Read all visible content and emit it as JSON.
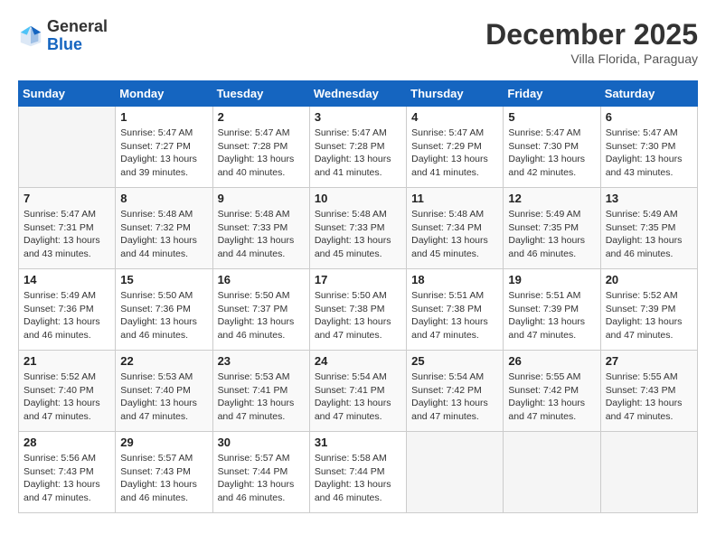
{
  "header": {
    "logo_general": "General",
    "logo_blue": "Blue",
    "month_title": "December 2025",
    "subtitle": "Villa Florida, Paraguay"
  },
  "weekdays": [
    "Sunday",
    "Monday",
    "Tuesday",
    "Wednesday",
    "Thursday",
    "Friday",
    "Saturday"
  ],
  "weeks": [
    [
      {
        "day": "",
        "empty": true
      },
      {
        "day": "1",
        "sunrise": "Sunrise: 5:47 AM",
        "sunset": "Sunset: 7:27 PM",
        "daylight": "Daylight: 13 hours and 39 minutes."
      },
      {
        "day": "2",
        "sunrise": "Sunrise: 5:47 AM",
        "sunset": "Sunset: 7:28 PM",
        "daylight": "Daylight: 13 hours and 40 minutes."
      },
      {
        "day": "3",
        "sunrise": "Sunrise: 5:47 AM",
        "sunset": "Sunset: 7:28 PM",
        "daylight": "Daylight: 13 hours and 41 minutes."
      },
      {
        "day": "4",
        "sunrise": "Sunrise: 5:47 AM",
        "sunset": "Sunset: 7:29 PM",
        "daylight": "Daylight: 13 hours and 41 minutes."
      },
      {
        "day": "5",
        "sunrise": "Sunrise: 5:47 AM",
        "sunset": "Sunset: 7:30 PM",
        "daylight": "Daylight: 13 hours and 42 minutes."
      },
      {
        "day": "6",
        "sunrise": "Sunrise: 5:47 AM",
        "sunset": "Sunset: 7:30 PM",
        "daylight": "Daylight: 13 hours and 43 minutes."
      }
    ],
    [
      {
        "day": "7",
        "sunrise": "Sunrise: 5:47 AM",
        "sunset": "Sunset: 7:31 PM",
        "daylight": "Daylight: 13 hours and 43 minutes."
      },
      {
        "day": "8",
        "sunrise": "Sunrise: 5:48 AM",
        "sunset": "Sunset: 7:32 PM",
        "daylight": "Daylight: 13 hours and 44 minutes."
      },
      {
        "day": "9",
        "sunrise": "Sunrise: 5:48 AM",
        "sunset": "Sunset: 7:33 PM",
        "daylight": "Daylight: 13 hours and 44 minutes."
      },
      {
        "day": "10",
        "sunrise": "Sunrise: 5:48 AM",
        "sunset": "Sunset: 7:33 PM",
        "daylight": "Daylight: 13 hours and 45 minutes."
      },
      {
        "day": "11",
        "sunrise": "Sunrise: 5:48 AM",
        "sunset": "Sunset: 7:34 PM",
        "daylight": "Daylight: 13 hours and 45 minutes."
      },
      {
        "day": "12",
        "sunrise": "Sunrise: 5:49 AM",
        "sunset": "Sunset: 7:35 PM",
        "daylight": "Daylight: 13 hours and 46 minutes."
      },
      {
        "day": "13",
        "sunrise": "Sunrise: 5:49 AM",
        "sunset": "Sunset: 7:35 PM",
        "daylight": "Daylight: 13 hours and 46 minutes."
      }
    ],
    [
      {
        "day": "14",
        "sunrise": "Sunrise: 5:49 AM",
        "sunset": "Sunset: 7:36 PM",
        "daylight": "Daylight: 13 hours and 46 minutes."
      },
      {
        "day": "15",
        "sunrise": "Sunrise: 5:50 AM",
        "sunset": "Sunset: 7:36 PM",
        "daylight": "Daylight: 13 hours and 46 minutes."
      },
      {
        "day": "16",
        "sunrise": "Sunrise: 5:50 AM",
        "sunset": "Sunset: 7:37 PM",
        "daylight": "Daylight: 13 hours and 46 minutes."
      },
      {
        "day": "17",
        "sunrise": "Sunrise: 5:50 AM",
        "sunset": "Sunset: 7:38 PM",
        "daylight": "Daylight: 13 hours and 47 minutes."
      },
      {
        "day": "18",
        "sunrise": "Sunrise: 5:51 AM",
        "sunset": "Sunset: 7:38 PM",
        "daylight": "Daylight: 13 hours and 47 minutes."
      },
      {
        "day": "19",
        "sunrise": "Sunrise: 5:51 AM",
        "sunset": "Sunset: 7:39 PM",
        "daylight": "Daylight: 13 hours and 47 minutes."
      },
      {
        "day": "20",
        "sunrise": "Sunrise: 5:52 AM",
        "sunset": "Sunset: 7:39 PM",
        "daylight": "Daylight: 13 hours and 47 minutes."
      }
    ],
    [
      {
        "day": "21",
        "sunrise": "Sunrise: 5:52 AM",
        "sunset": "Sunset: 7:40 PM",
        "daylight": "Daylight: 13 hours and 47 minutes."
      },
      {
        "day": "22",
        "sunrise": "Sunrise: 5:53 AM",
        "sunset": "Sunset: 7:40 PM",
        "daylight": "Daylight: 13 hours and 47 minutes."
      },
      {
        "day": "23",
        "sunrise": "Sunrise: 5:53 AM",
        "sunset": "Sunset: 7:41 PM",
        "daylight": "Daylight: 13 hours and 47 minutes."
      },
      {
        "day": "24",
        "sunrise": "Sunrise: 5:54 AM",
        "sunset": "Sunset: 7:41 PM",
        "daylight": "Daylight: 13 hours and 47 minutes."
      },
      {
        "day": "25",
        "sunrise": "Sunrise: 5:54 AM",
        "sunset": "Sunset: 7:42 PM",
        "daylight": "Daylight: 13 hours and 47 minutes."
      },
      {
        "day": "26",
        "sunrise": "Sunrise: 5:55 AM",
        "sunset": "Sunset: 7:42 PM",
        "daylight": "Daylight: 13 hours and 47 minutes."
      },
      {
        "day": "27",
        "sunrise": "Sunrise: 5:55 AM",
        "sunset": "Sunset: 7:43 PM",
        "daylight": "Daylight: 13 hours and 47 minutes."
      }
    ],
    [
      {
        "day": "28",
        "sunrise": "Sunrise: 5:56 AM",
        "sunset": "Sunset: 7:43 PM",
        "daylight": "Daylight: 13 hours and 47 minutes."
      },
      {
        "day": "29",
        "sunrise": "Sunrise: 5:57 AM",
        "sunset": "Sunset: 7:43 PM",
        "daylight": "Daylight: 13 hours and 46 minutes."
      },
      {
        "day": "30",
        "sunrise": "Sunrise: 5:57 AM",
        "sunset": "Sunset: 7:44 PM",
        "daylight": "Daylight: 13 hours and 46 minutes."
      },
      {
        "day": "31",
        "sunrise": "Sunrise: 5:58 AM",
        "sunset": "Sunset: 7:44 PM",
        "daylight": "Daylight: 13 hours and 46 minutes."
      },
      {
        "day": "",
        "empty": true
      },
      {
        "day": "",
        "empty": true
      },
      {
        "day": "",
        "empty": true
      }
    ]
  ]
}
